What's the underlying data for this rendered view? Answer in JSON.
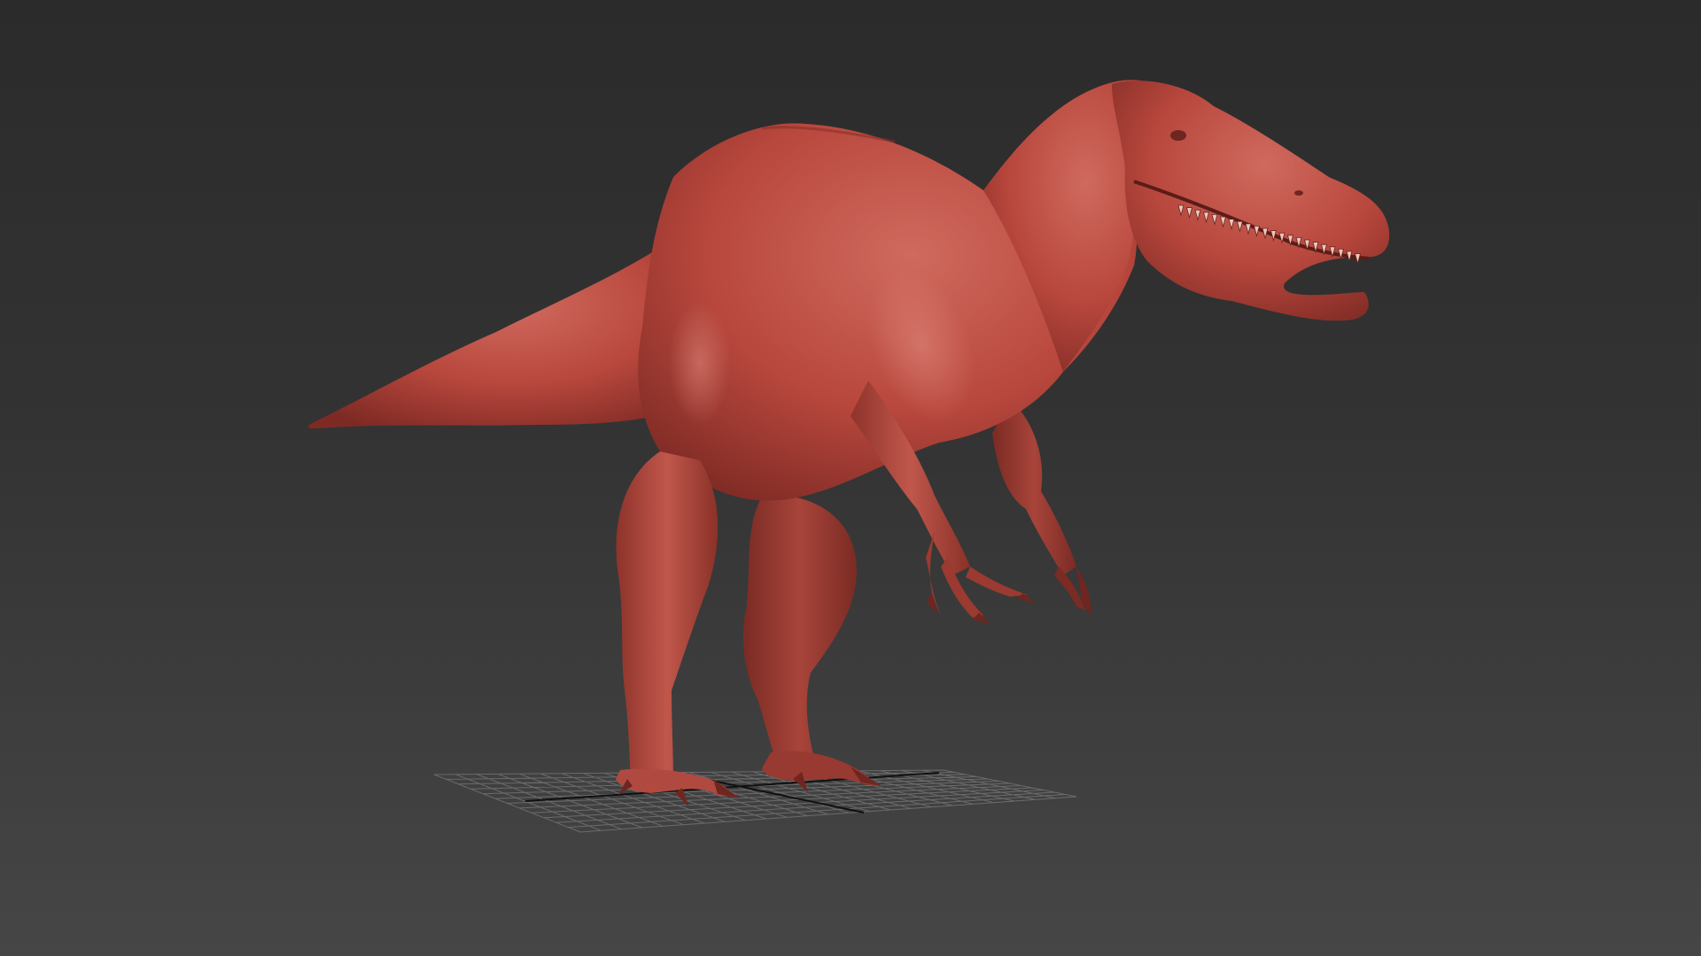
{
  "viewport": {
    "background_top": "#2b2b2b",
    "background_bottom": "#464646",
    "model": {
      "kind": "dinosaur-sculpt",
      "clay_color": "#b8473d",
      "clay_shadow": "#7e2a24",
      "clay_highlight": "#d06a5e"
    },
    "grid": {
      "visible": true,
      "color": "#7a7a7a",
      "axis_color": "#111111"
    }
  }
}
